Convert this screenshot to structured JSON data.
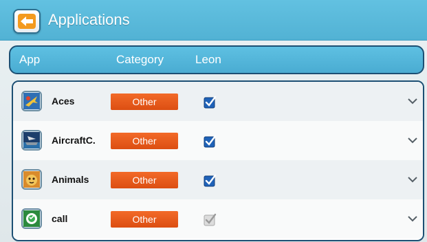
{
  "titlebar": {
    "back_icon": "arrow-left-icon",
    "title": "Applications"
  },
  "header": {
    "col_app": "App",
    "col_category": "Category",
    "col_user": "Leon"
  },
  "colors": {
    "titlebar": "#5bb9dc",
    "category_badge": "#e85a1c",
    "checkbox_checked": "#1f62b8",
    "checkbox_unchecked": "#c8c8c8"
  },
  "apps": [
    {
      "name": "Aces",
      "category": "Other",
      "checked": true,
      "icon": "jet-fighter-icon"
    },
    {
      "name": "AircraftC.",
      "category": "Other",
      "checked": true,
      "icon": "aircraft-carrier-icon"
    },
    {
      "name": "Animals",
      "category": "Other",
      "checked": true,
      "icon": "animal-icon"
    },
    {
      "name": "call",
      "category": "Other",
      "checked": false,
      "icon": "phone-call-icon"
    }
  ]
}
